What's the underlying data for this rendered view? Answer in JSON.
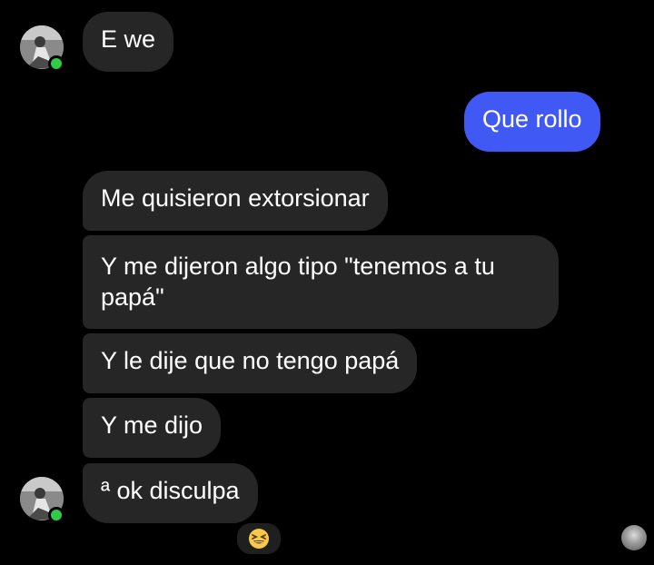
{
  "messages": [
    {
      "id": "m1",
      "text": "E we",
      "direction": "incoming"
    },
    {
      "id": "m2",
      "text": "Que rollo",
      "direction": "outgoing"
    },
    {
      "id": "m3",
      "text": "Me quisieron extorsionar",
      "direction": "incoming"
    },
    {
      "id": "m4",
      "text": "Y me dijeron algo tipo \"tenemos a tu papá\"",
      "direction": "incoming"
    },
    {
      "id": "m5",
      "text": "Y le dije que no tengo papá",
      "direction": "incoming"
    },
    {
      "id": "m6",
      "text": "Y me dijo",
      "direction": "incoming"
    },
    {
      "id": "m7",
      "text": "ª ok disculpa",
      "direction": "incoming"
    }
  ],
  "reaction": {
    "icon": "grinning-squinting-face-icon",
    "emoji": "😆"
  },
  "colors": {
    "background": "#000000",
    "incoming_bubble": "#262626",
    "outgoing_bubble": "#4159f4",
    "online": "#31cc46"
  }
}
